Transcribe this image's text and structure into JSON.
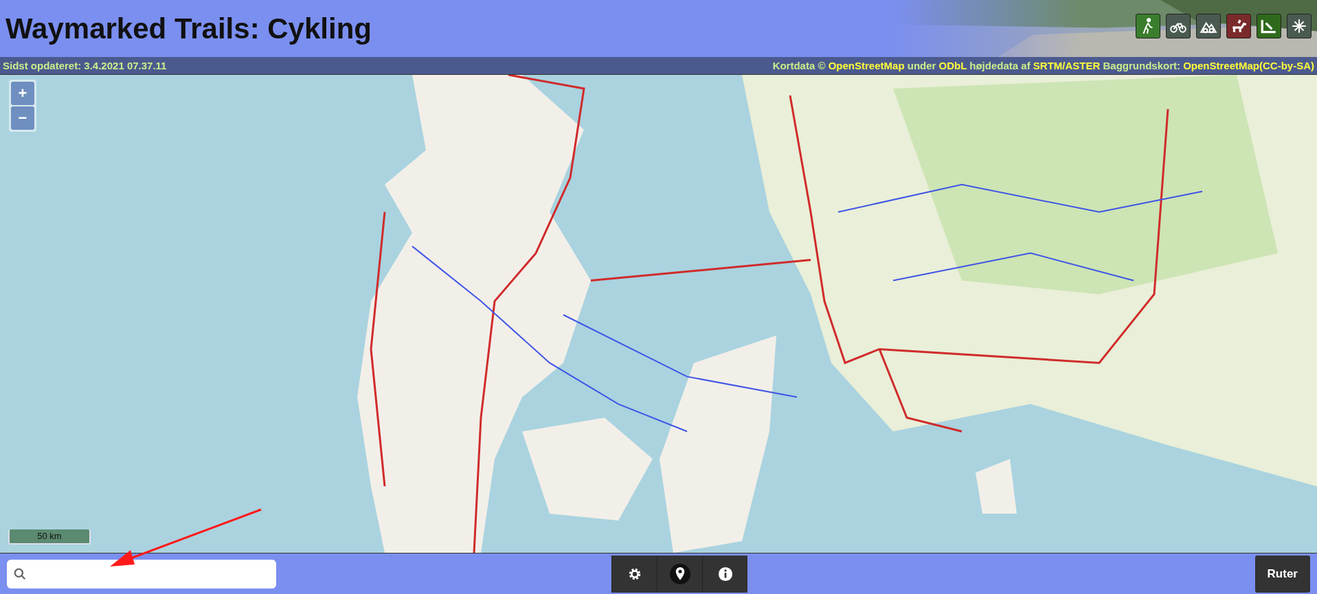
{
  "header": {
    "title": "Waymarked Trails: Cykling",
    "activities": [
      {
        "kind": "hiking",
        "color": "#3a7d2c"
      },
      {
        "kind": "cycling",
        "color": "#4a5a50"
      },
      {
        "kind": "mtb",
        "color": "#4a5a50"
      },
      {
        "kind": "riding",
        "color": "#7a2a2a"
      },
      {
        "kind": "slopes",
        "color": "#2f6a1c"
      },
      {
        "kind": "skating",
        "color": "#4a5a50"
      }
    ]
  },
  "info_bar": {
    "updated": "Sidst opdateret: 3.4.2021 07.37.11",
    "attribution": [
      {
        "text": "Kortdata © ",
        "link": false
      },
      {
        "text": "OpenStreetMap",
        "link": true
      },
      {
        "text": " under ",
        "link": false
      },
      {
        "text": "ODbL",
        "link": true
      },
      {
        "text": " højdedata af ",
        "link": false
      },
      {
        "text": "SRTM/ASTER",
        "link": true
      },
      {
        "text": " Baggrundskort: ",
        "link": false
      },
      {
        "text": "OpenStreetMap(CC-by-SA)",
        "link": true
      }
    ]
  },
  "map": {
    "kind": "picture",
    "zoom_controls": [
      "+",
      "−"
    ],
    "scale": "50 km"
  },
  "bottom_bar": {
    "tools": [
      {
        "kind": "settings"
      },
      {
        "kind": "location"
      },
      {
        "kind": "info"
      }
    ],
    "route_button": "Ruter"
  },
  "annotation": {
    "kind": "arrow"
  }
}
